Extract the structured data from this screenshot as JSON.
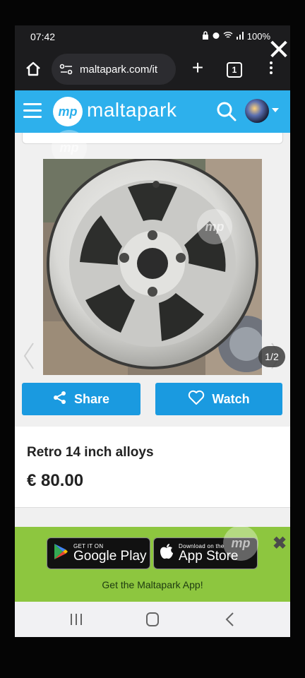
{
  "status_bar": {
    "time": "07:42",
    "battery": "100%"
  },
  "browser": {
    "url": "maltapark.com/it",
    "tab_count": "1"
  },
  "site": {
    "logo_mark": "mp",
    "name": "maltapark"
  },
  "gallery": {
    "counter": "1/2"
  },
  "actions": {
    "share_label": "Share",
    "watch_label": "Watch"
  },
  "listing": {
    "title": "Retro 14 inch alloys",
    "price": "€ 80.00"
  },
  "app_banner": {
    "google_play_small": "GET IT ON",
    "google_play_big": "Google Play",
    "app_store_small": "Download on the",
    "app_store_big": "App Store",
    "cta": "Get the Maltapark App!"
  },
  "icons": [
    "home-icon",
    "tune-icon",
    "plus-icon",
    "tabs-icon",
    "menu-icon",
    "hamburger-icon",
    "search-icon",
    "share-icon",
    "heart-icon",
    "close-icon",
    "google-play-icon",
    "apple-icon",
    "recents-icon",
    "home-nav-icon",
    "back-icon"
  ],
  "colors": {
    "brand_blue": "#2db0ec",
    "button_blue": "#1a9ae0",
    "banner_green": "#8dc63f"
  }
}
